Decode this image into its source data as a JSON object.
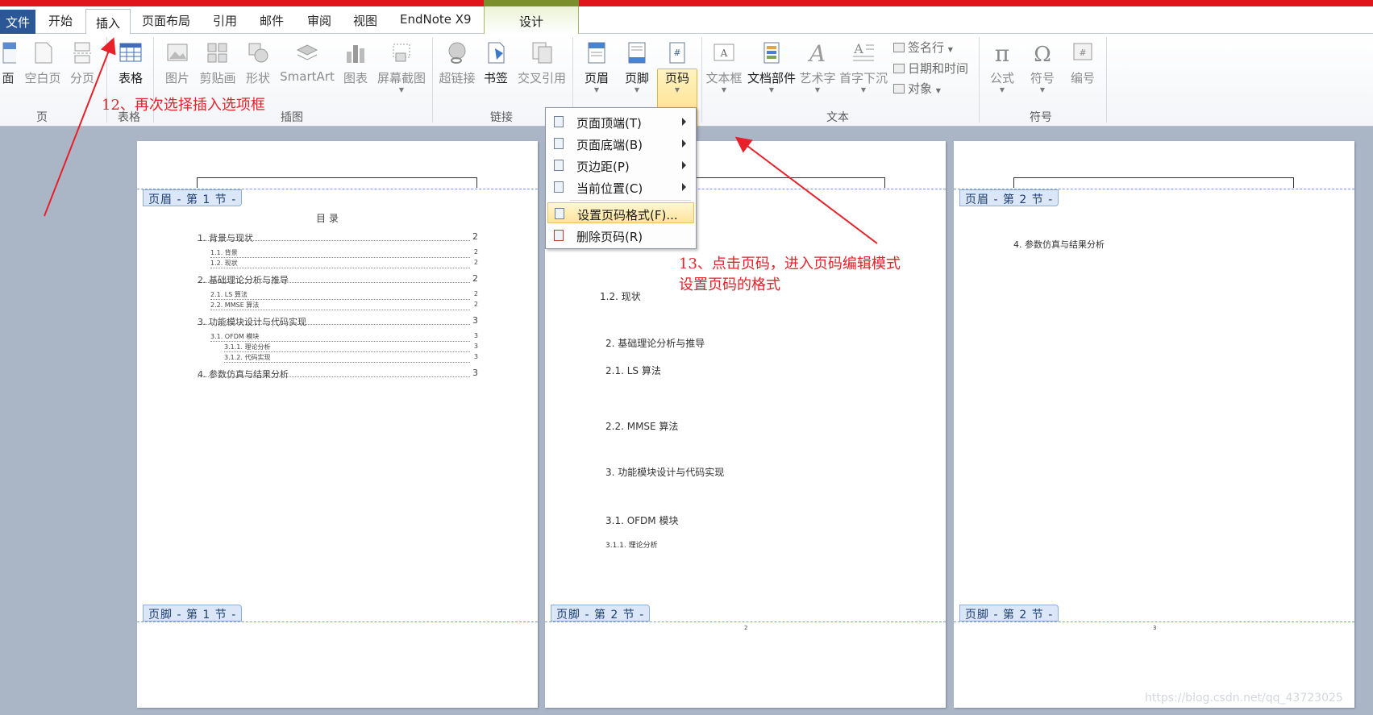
{
  "tabs": {
    "file": "文件",
    "home": "开始",
    "insert": "插入",
    "layout": "页面布局",
    "references": "引用",
    "mailings": "邮件",
    "review": "审阅",
    "view": "视图",
    "endnote": "EndNote X9",
    "design": "设计"
  },
  "ribbon": {
    "pages": {
      "cover": "面",
      "blank": "空白页",
      "break": "分页",
      "group": "页"
    },
    "tables": {
      "table": "表格",
      "group": "表格"
    },
    "illustrations": {
      "picture": "图片",
      "clipart": "剪贴画",
      "shapes": "形状",
      "smartart": "SmartArt",
      "chart": "图表",
      "screenshot": "屏幕截图",
      "group": "插图"
    },
    "links": {
      "hyperlink": "超链接",
      "bookmark": "书签",
      "crossref": "交叉引用",
      "group": "链接"
    },
    "headerfooter": {
      "header": "页眉",
      "footer": "页脚",
      "pagenum": "页码"
    },
    "text": {
      "textbox": "文本框",
      "quickparts": "文档部件",
      "wordart": "艺术字",
      "dropcap": "首字下沉",
      "signature": "签名行",
      "datetime": "日期和时间",
      "object": "对象",
      "group": "文本"
    },
    "symbols": {
      "equation": "公式",
      "symbol": "符号",
      "number": "编号",
      "group": "符号"
    }
  },
  "menu": {
    "items": [
      {
        "label": "页面顶端(T)"
      },
      {
        "label": "页面底端(B)"
      },
      {
        "label": "页边距(P)"
      },
      {
        "label": "当前位置(C)"
      },
      {
        "label": "设置页码格式(F)..."
      },
      {
        "label": "删除页码(R)"
      }
    ]
  },
  "pages": {
    "p1": {
      "header_tag": "页眉 - 第 1 节 -",
      "footer_tag": "页脚 - 第 1 节 -",
      "toc_title": "目    录",
      "toc": [
        {
          "text": "1. 背景与现状",
          "num": "2"
        },
        {
          "text": "1.1. 背景",
          "num": "2"
        },
        {
          "text": "1.2. 现状",
          "num": "2"
        },
        {
          "text": "2. 基础理论分析与推导",
          "num": "2"
        },
        {
          "text": "2.1. LS 算法",
          "num": "2"
        },
        {
          "text": "2.2. MMSE 算法",
          "num": "2"
        },
        {
          "text": "3. 功能模块设计与代码实现",
          "num": "3"
        },
        {
          "text": "3.1. OFDM 模块",
          "num": "3"
        },
        {
          "text": "3.1.1. 理论分析",
          "num": "3"
        },
        {
          "text": "3.1.2. 代码实现",
          "num": "3"
        },
        {
          "text": "4. 参数仿真与结果分析",
          "num": "3"
        }
      ]
    },
    "p2": {
      "footer_tag": "页脚 - 第 2 节 -",
      "lines": [
        "1.2. 现状",
        "2. 基础理论分析与推导",
        "2.1. LS 算法",
        "2.2. MMSE 算法",
        "3. 功能模块设计与代码实现",
        "3.1. OFDM 模块",
        "3.1.1. 理论分析"
      ],
      "page_num": "2"
    },
    "p3": {
      "header_tag": "页眉 - 第 2 节 -",
      "footer_tag": "页脚 - 第 2 节 -",
      "line": "4. 参数仿真与结果分析",
      "page_num": "3"
    }
  },
  "annotations": {
    "step12": "12、再次选择插入选项框",
    "step13_line1": "13、点击页码，进入页码编辑模式",
    "step13_line2": "设置页码的格式"
  },
  "watermark": "https://blog.csdn.net/qq_43723025",
  "colors": {
    "file_tab": "#2b5797",
    "annotation": "#e8202a",
    "highlight": "#fde49a",
    "page_bg": "#aab5c6"
  }
}
